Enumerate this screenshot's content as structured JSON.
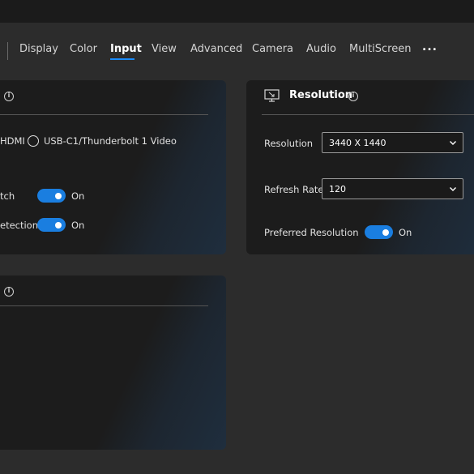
{
  "nav": {
    "tabs": [
      {
        "label": "Display"
      },
      {
        "label": "Color"
      },
      {
        "label": "Input"
      },
      {
        "label": "View"
      },
      {
        "label": "Advanced"
      },
      {
        "label": "Camera"
      },
      {
        "label": "Audio"
      },
      {
        "label": "MultiScreen"
      }
    ],
    "active_tab": "Input",
    "more_label": "..."
  },
  "input_panel": {
    "options": {
      "hdmi_label": "HDMI",
      "usbc_label": "USB-C1/Thunderbolt 1 Video"
    },
    "rows": [
      {
        "label": "tch",
        "state": "On"
      },
      {
        "label": "etection",
        "state": "On"
      }
    ]
  },
  "resolution_panel": {
    "title": "Resolution",
    "resolution_label": "Resolution",
    "resolution_value": "3440 X 1440",
    "refresh_label": "Refresh Rate",
    "refresh_value": "120",
    "preferred_label": "Preferred Resolution",
    "preferred_state": "On"
  },
  "icons": {
    "monitor": "monitor-icon",
    "info": "info-icon",
    "chevron": "chevron-down-icon"
  },
  "colors": {
    "accent": "#1a7ee0",
    "background": "#2c2c2c",
    "panel": "#1c1c1c"
  }
}
